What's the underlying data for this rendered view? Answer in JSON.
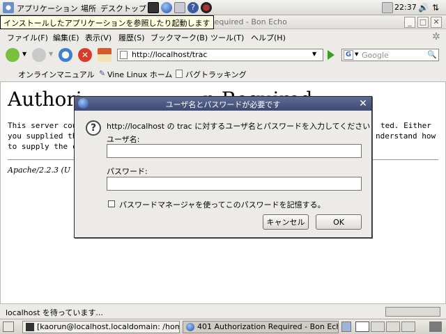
{
  "top_panel": {
    "applications": "アプリケーション",
    "places": "場所",
    "desktop": "デスクトップ",
    "clock": "22:37"
  },
  "tooltip": "インストールしたアプリケーションを参照したり起動します",
  "window": {
    "title": "n Required - Bon Echo"
  },
  "menu": [
    "ファイル(F)",
    "編集(E)",
    "表示(V)",
    "履歴(S)",
    "ブックマーク(B)",
    "ツール(T)",
    "ヘルプ(H)"
  ],
  "navbar": {
    "url": "http://localhost/trac",
    "search_placeholder": "Google"
  },
  "bookmarks": [
    "オンラインマニュアル",
    "Vine Linux ホーム",
    "バグトラッキング"
  ],
  "page": {
    "heading_left": "Authori",
    "heading_right": "n Required",
    "line1_left": "This server cou",
    "line1_right": "ted. Either",
    "line2_left": "you supplied th",
    "line2_right": "nderstand how",
    "line3_left": "to supply the c",
    "address": "Apache/2.2.3 (U"
  },
  "status": "localhost を待っています...",
  "taskbar": {
    "terminal": "[kaorun@localhost.localdomain: /hom…",
    "browser": "401 Authorization Required - Bon Echo"
  },
  "dialog": {
    "title": "ユーザ名とパスワードが必要です",
    "message": "http://localhost の trac に対するユーザ名とパスワードを入力してください",
    "username_label": "ユーザ名:",
    "username_value": "",
    "password_label": "パスワード:",
    "password_value": "",
    "remember_label": "パスワードマネージャを使ってこのパスワードを記憶する。",
    "remember_checked": false,
    "cancel_label": "キャンセル",
    "ok_label": "OK"
  },
  "colors": {
    "dialog_title_bg": "#4a5680",
    "tooltip_bg": "#ffffe1",
    "panel_bg": "#dcdad5"
  }
}
